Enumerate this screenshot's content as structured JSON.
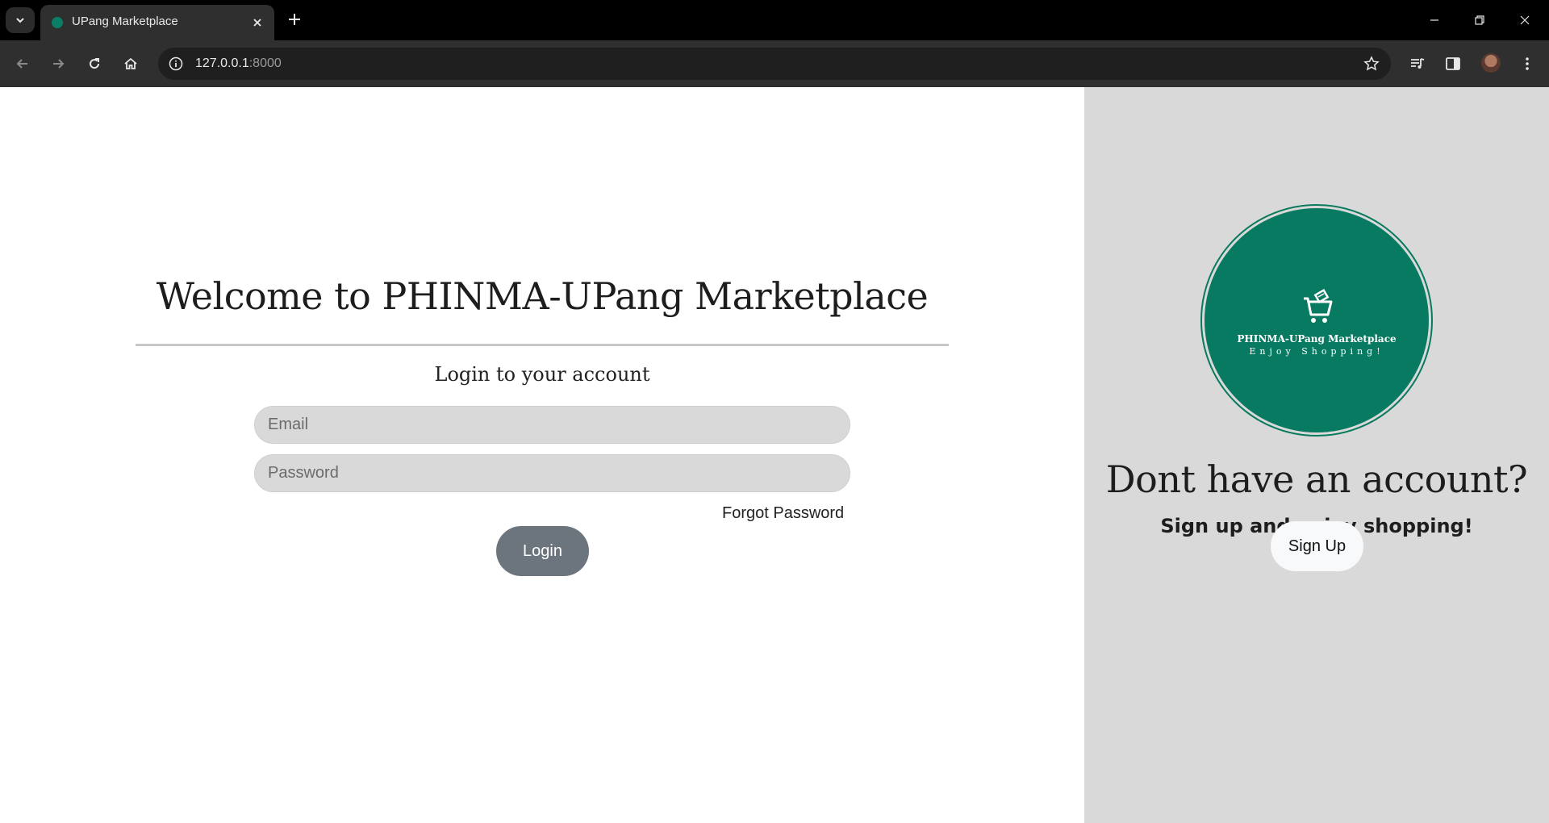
{
  "browser": {
    "tab_title": "UPang Marketplace",
    "url_host": "127.0.0.1",
    "url_port": ":8000"
  },
  "login": {
    "heading": "Welcome to PHINMA-UPang Marketplace",
    "subtitle": "Login to your account",
    "email_placeholder": "Email",
    "password_placeholder": "Password",
    "forgot_password": "Forgot Password",
    "login_button": "Login"
  },
  "signup": {
    "logo_name": "PHINMA-UPang Marketplace",
    "logo_tagline": "Enjoy Shopping!",
    "heading": "Dont have an account?",
    "subtitle": "Sign up and enjoy shopping!",
    "signup_button": "Sign Up"
  },
  "colors": {
    "brand_green": "#087a62",
    "login_button": "#6c757d",
    "right_panel": "#d9d9d9"
  }
}
